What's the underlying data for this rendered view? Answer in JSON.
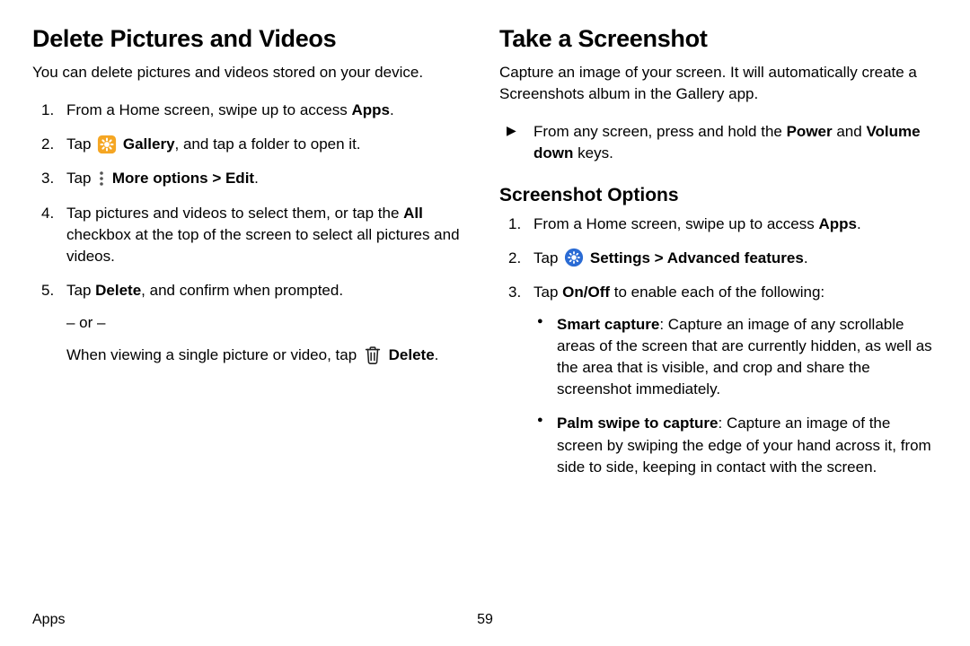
{
  "left": {
    "title": "Delete Pictures and Videos",
    "intro": "You can delete pictures and videos stored on your device.",
    "step1_a": "From a Home screen, swipe up to access ",
    "step1_b": "Apps",
    "step1_c": ".",
    "step2_a": "Tap ",
    "step2_b": "Gallery",
    "step2_c": ", and tap a folder to open it.",
    "step3_a": "Tap ",
    "step3_b": "More options",
    "step3_c": "Edit",
    "step3_d": ".",
    "step4_a": "Tap pictures and videos to select them, or tap the ",
    "step4_b": "All",
    "step4_c": " checkbox at the top of the screen to select all pictures and videos.",
    "step5_a": "Tap ",
    "step5_b": "Delete",
    "step5_c": ", and confirm when prompted.",
    "or": "– or –",
    "alt_a": "When viewing a single picture or video, tap ",
    "alt_b": "Delete",
    "alt_c": "."
  },
  "right": {
    "title": "Take a Screenshot",
    "intro": "Capture an image of your screen. It will automatically create a Screenshots album in the Gallery app.",
    "arrow_a": "From any screen, press and hold the ",
    "arrow_b": "Power",
    "arrow_c": " and ",
    "arrow_d": "Volume down",
    "arrow_e": " keys.",
    "sub_title": "Screenshot Options",
    "s1_a": "From a Home screen, swipe up to access ",
    "s1_b": "Apps",
    "s1_c": ".",
    "s2_a": "Tap ",
    "s2_b": "Settings",
    "s2_c": "Advanced features",
    "s2_d": ".",
    "s3_a": "Tap ",
    "s3_b": "On/Off",
    "s3_c": " to enable each of the following:",
    "b1_a": "Smart capture",
    "b1_b": ": Capture an image of any scrollable areas of the screen that are currently hidden, as well as the area that is visible, and crop and share the screenshot immediately.",
    "b2_a": "Palm swipe to capture",
    "b2_b": ": Capture an image of the screen by swiping the edge of your hand across it, from side to side, keeping in contact with the screen."
  },
  "footer": {
    "section": "Apps",
    "page": "59"
  },
  "glyphs": {
    "chevron": " > "
  }
}
